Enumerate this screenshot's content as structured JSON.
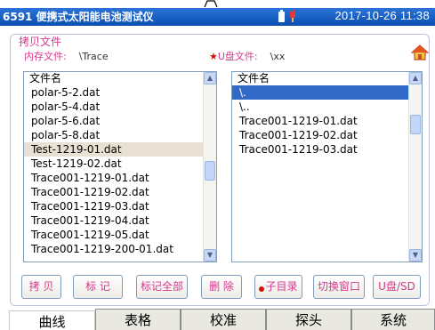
{
  "titlebar": {
    "title": "6591 便携式太阳能电池测试仪",
    "datetime": "2017-10-26  11:38"
  },
  "panel": {
    "title": "拷贝文件",
    "internal_label": "内存文件:",
    "internal_path": "\\Trace",
    "usb_label": "U盘文件:",
    "usb_path": "\\xx"
  },
  "left_list": {
    "header": "文件名",
    "items": [
      "polar-5-2.dat",
      "polar-5-4.dat",
      "polar-5-6.dat",
      "polar-5-8.dat",
      "Test-1219-01.dat",
      "Test-1219-02.dat",
      "Trace001-1219-01.dat",
      "Trace001-1219-02.dat",
      "Trace001-1219-03.dat",
      "Trace001-1219-04.dat",
      "Trace001-1219-05.dat",
      "Trace001-1219-200-01.dat"
    ],
    "highlighted_index": 4
  },
  "right_list": {
    "header": "文件名",
    "items": [
      "\\.",
      "\\..",
      "Trace001-1219-01.dat",
      "Trace001-1219-02.dat",
      "Trace001-1219-03.dat"
    ],
    "selected_index": 0
  },
  "buttons": {
    "copy": "拷 贝",
    "mark": "标 记",
    "mark_all": "标记全部",
    "delete": "删 除",
    "subdir": "子目录",
    "switch_window": "切换窗口",
    "usb_sd": "U盘/SD"
  },
  "tabs": [
    "曲线",
    "表格",
    "校准",
    "探头",
    "系统"
  ],
  "active_tab": 0,
  "colors": {
    "titlebar": "#0b4fb0",
    "accent_pink": "#d43a8c",
    "selection": "#3169c6",
    "highlight": "#e8e1d3"
  },
  "icons": {
    "battery": "battery-icon",
    "plug": "plug-icon",
    "home": "home-icon",
    "star": "star-icon"
  }
}
